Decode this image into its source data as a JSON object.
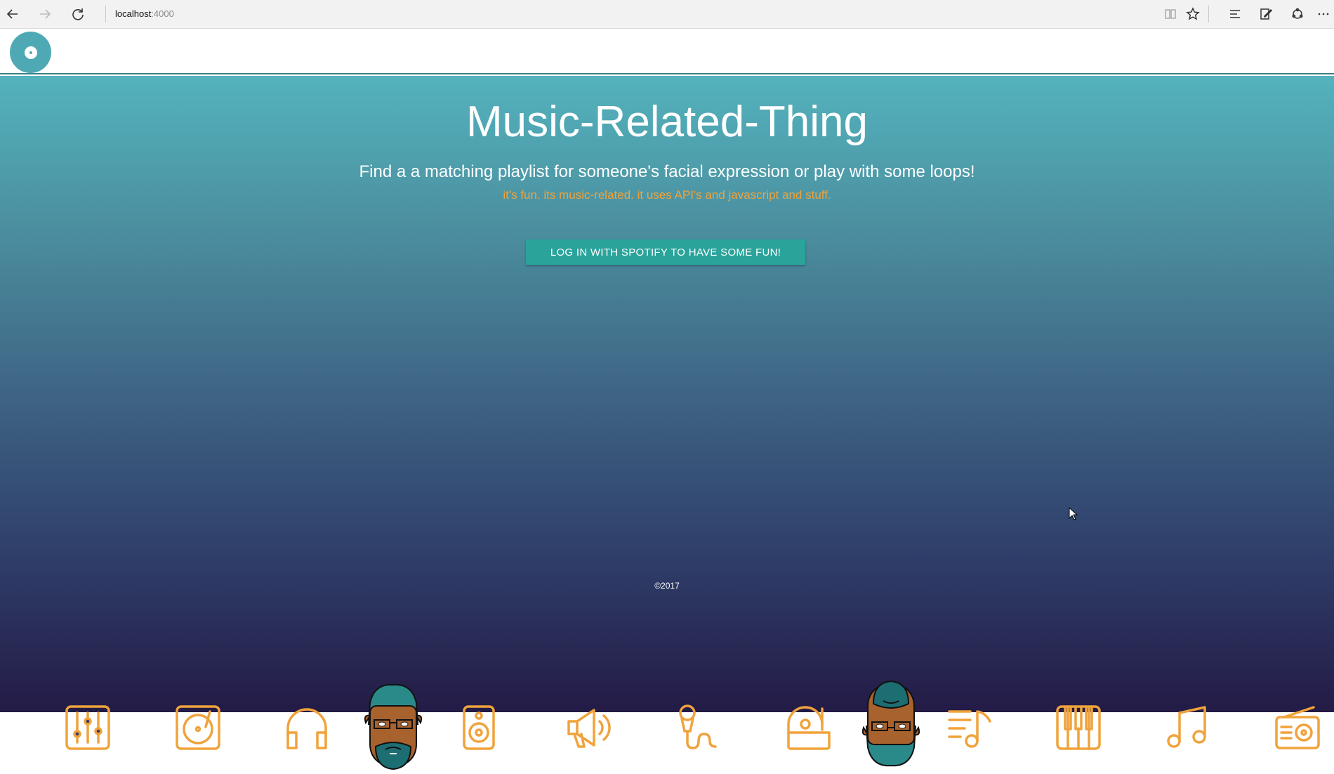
{
  "browser": {
    "address_host": "localhost",
    "address_port": ":4000"
  },
  "hero": {
    "title": "Music-Related-Thing",
    "subtitle": "Find a a matching playlist for someone's facial expression or play with some loops!",
    "tagline": "it's fun. its music-related. it uses API's and javascript and stuff.",
    "login_label": "LOG IN WITH SPOTIFY TO HAVE SOME FUN!"
  },
  "footer": {
    "copyright": "©2017"
  },
  "icons": [
    "mixer-sliders-icon",
    "turntable-icon",
    "headphones-icon",
    "face-avatar",
    "speaker-icon",
    "megaphone-icon",
    "microphone-icon",
    "record-player-icon",
    "face-avatar-upside-down",
    "playlist-note-icon",
    "piano-keys-icon",
    "music-note-icon",
    "radio-icon"
  ],
  "colors": {
    "accent": "#f0a33c",
    "button": "#2aa39b",
    "logo": "#4fa9b5",
    "gradient_top": "#53b3bd",
    "gradient_bottom": "#231b46"
  }
}
